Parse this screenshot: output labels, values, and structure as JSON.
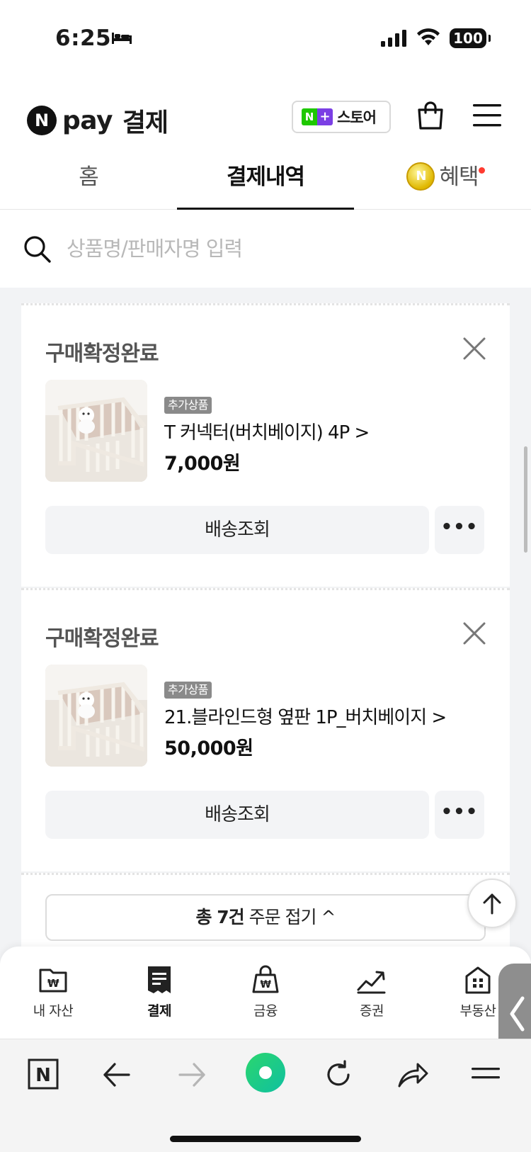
{
  "status_bar": {
    "time": "6:25",
    "battery": "100"
  },
  "header": {
    "logo_n": "N",
    "logo_pay": "pay",
    "title": "결제",
    "store_badge_n": "N",
    "store_badge_plus": "+",
    "store_label": "스토어"
  },
  "tabs": [
    {
      "label": "홈"
    },
    {
      "label": "결제내역"
    },
    {
      "label": "혜택",
      "coin_label": "N"
    }
  ],
  "search": {
    "placeholder": "상품명/판매자명 입력"
  },
  "orders": [
    {
      "status": "구매확정완료",
      "badge": "추가상품",
      "product_name": "T 커넥터(버치베이지) 4P >",
      "price": "7,000원",
      "ship_button": "배송조회",
      "more_button": "•••"
    },
    {
      "status": "구매확정완료",
      "badge": "추가상품",
      "product_name": "21.블라인드형 옆판 1P_버치베이지 >",
      "price": "50,000원",
      "ship_button": "배송조회",
      "more_button": "•••"
    }
  ],
  "collapse": {
    "total_label": "총 7건",
    "rest_label": "주문 접기 ^"
  },
  "bottom_nav": [
    {
      "label": "내 자산",
      "icon": "wallet-icon"
    },
    {
      "label": "결제",
      "icon": "receipt-icon",
      "active": true
    },
    {
      "label": "금융",
      "icon": "money-bag-icon"
    },
    {
      "label": "증권",
      "icon": "stock-chart-icon"
    },
    {
      "label": "부동산",
      "icon": "building-icon"
    }
  ],
  "browser_bar": {
    "n_label": "N"
  },
  "colors": {
    "naver_green": "#1ec800",
    "plus_purple": "#7b3fe4",
    "badge_gray": "#8a8a8a",
    "notification_red": "#ff3b30"
  }
}
